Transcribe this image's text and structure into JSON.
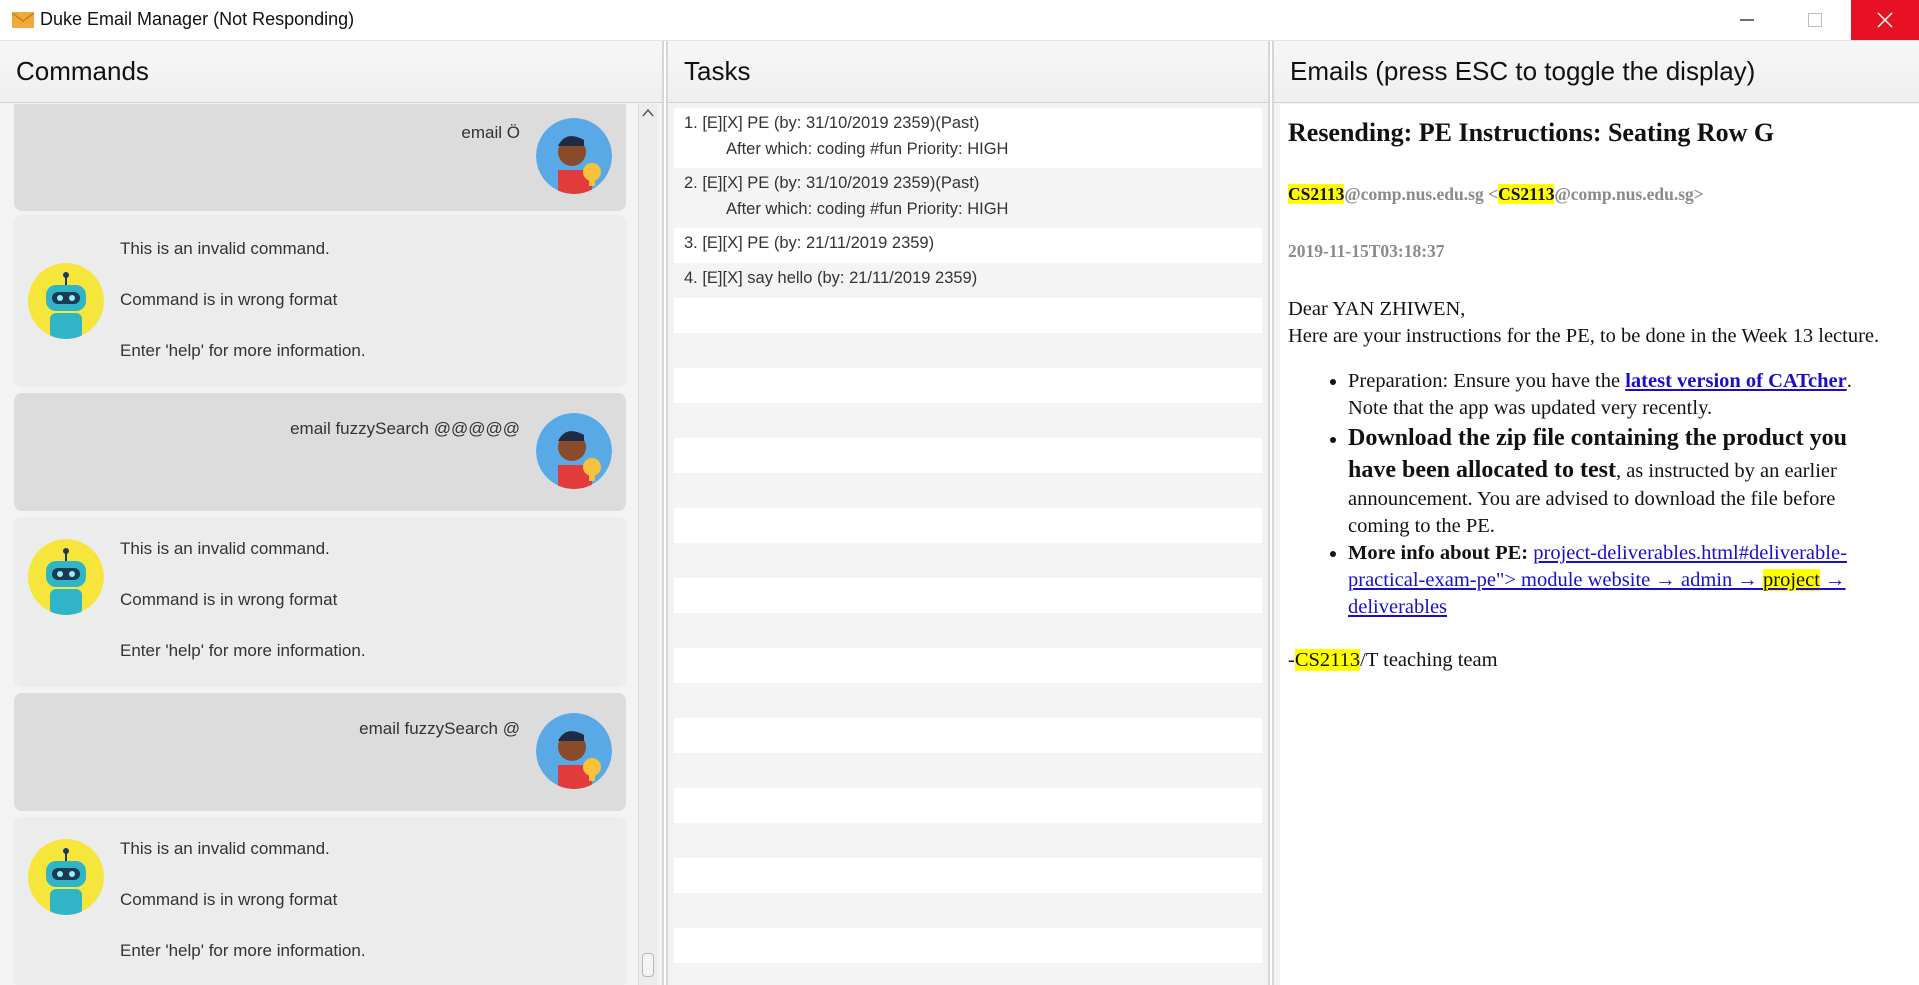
{
  "window": {
    "title": "Duke Email Manager (Not Responding)",
    "icon": "envelope-icon"
  },
  "commands": {
    "header": "Commands",
    "messages": [
      {
        "role": "user",
        "text": "email Ö"
      },
      {
        "role": "bot",
        "lines": [
          "This is an invalid command.",
          "Command is in wrong format",
          "Enter 'help' for more information."
        ]
      },
      {
        "role": "user",
        "text": "email fuzzySearch @@@@@"
      },
      {
        "role": "bot",
        "lines": [
          "This is an invalid command.",
          "Command is in wrong format",
          "Enter 'help' for more information."
        ]
      },
      {
        "role": "user",
        "text": "email fuzzySearch @"
      },
      {
        "role": "bot",
        "lines": [
          "This is an invalid command.",
          "Command is in wrong format",
          "Enter 'help' for more information."
        ]
      }
    ]
  },
  "tasks": {
    "header": "Tasks",
    "items": [
      {
        "line1": "1. [E][X] PE (by: 31/10/2019 2359)(Past)",
        "line2": "After which: coding #fun Priority: HIGH"
      },
      {
        "line1": "2. [E][X] PE (by: 31/10/2019 2359)(Past)",
        "line2": "After which: coding #fun Priority: HIGH"
      },
      {
        "line1": "3. [E][X] PE (by: 21/11/2019 2359)",
        "line2": ""
      },
      {
        "line1": "4. [E][X] say hello (by: 21/11/2019 2359)",
        "line2": ""
      }
    ]
  },
  "emails": {
    "header": "Emails (press ESC to toggle the display)",
    "subject": "Resending: PE Instructions: Seating Row G",
    "from_highlight": "CS2113",
    "from_rest1": "@comp.nus.edu.sg <",
    "from_rest2": "@comp.nus.edu.sg>",
    "date": "2019-11-15T03:18:37",
    "greeting": "Dear YAN ZHIWEN,",
    "intro": "Here are your instructions for the PE, to be done in the Week 13 lecture.",
    "bullet1_pre": "Preparation: Ensure you have the ",
    "bullet1_link": "latest version of CATcher",
    "bullet1_post": ". Note that the app was updated very recently.",
    "bullet2_bold": "Download the zip file containing the product you have been allocated to test",
    "bullet2_post": ", as instructed by an earlier announcement. You are advised to download the file before coming to the PE.",
    "bullet3_bold": "More info about PE: ",
    "bullet3_link_a": "project-deliverables.html#deliverable-practical-exam-pe\"> module website → admin → ",
    "bullet3_link_hl": "project",
    "bullet3_link_b": " → deliverables",
    "signoff_pre": "-",
    "signoff_hl": "CS2113",
    "signoff_post": "/T teaching team"
  },
  "colors": {
    "highlight": "#ffff00",
    "close_button": "#e81123",
    "link": "#1a0dcc"
  }
}
